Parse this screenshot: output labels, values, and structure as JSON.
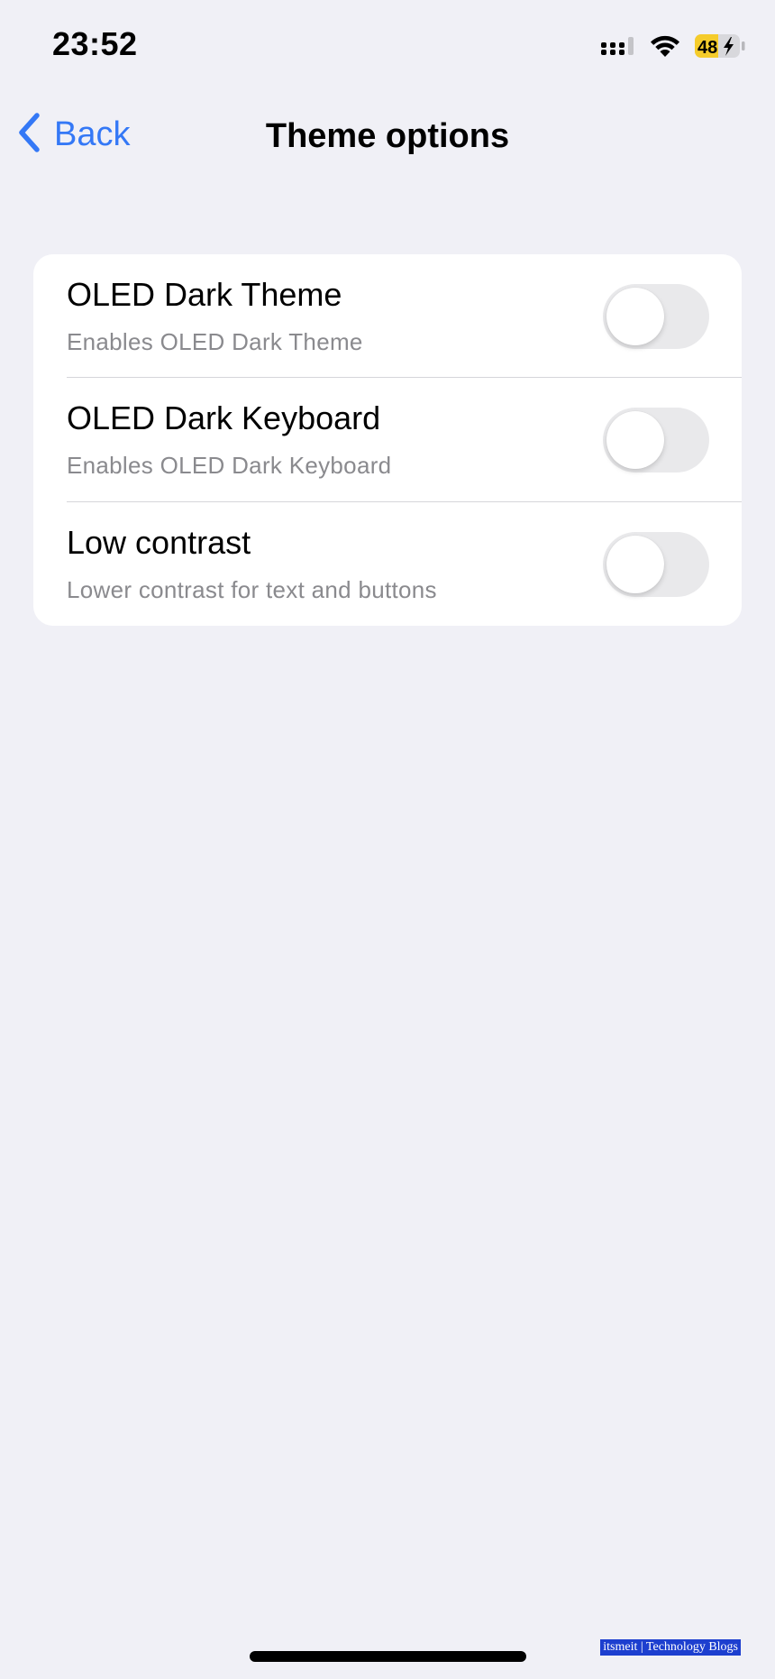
{
  "status_bar": {
    "time": "23:52",
    "battery_level": "48",
    "battery_charging": true,
    "icons": [
      "signal-icon",
      "wifi-icon",
      "battery-icon"
    ]
  },
  "nav": {
    "back_label": "Back",
    "title": "Theme options"
  },
  "settings": {
    "items": [
      {
        "title": "OLED Dark Theme",
        "subtitle": "Enables OLED Dark Theme",
        "enabled": false
      },
      {
        "title": "OLED Dark Keyboard",
        "subtitle": "Enables OLED Dark Keyboard",
        "enabled": false
      },
      {
        "title": "Low contrast",
        "subtitle": "Lower contrast for text and buttons",
        "enabled": false
      }
    ]
  },
  "watermark": "itsmeit | Technology Blogs",
  "colors": {
    "background": "#f0f0f6",
    "card": "#ffffff",
    "accent": "#3478f6",
    "secondary_text": "#8a8a8e",
    "toggle_off": "#e9e9eb",
    "battery_fill": "#f5cc2b",
    "watermark_bg": "#1d3fcf"
  }
}
